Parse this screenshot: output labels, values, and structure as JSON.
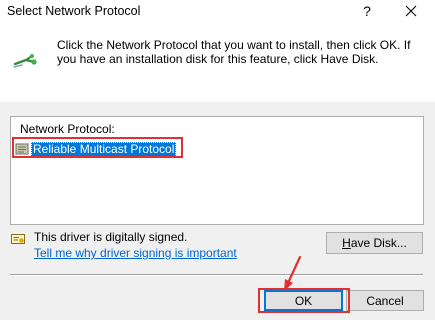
{
  "window": {
    "title": "Select Network Protocol",
    "help_glyph": "?",
    "close_glyph": "✕"
  },
  "instructions": "Click the Network Protocol that you want to install, then click OK. If you have an installation disk for this feature, click Have Disk.",
  "protocol_list": {
    "label": "Network Protocol:",
    "items": [
      {
        "label": "Reliable Multicast Protocol",
        "selected": true,
        "icon": "protocol-icon"
      }
    ]
  },
  "driver_info": {
    "status": "This driver is digitally signed.",
    "link": "Tell me why driver signing is important"
  },
  "buttons": {
    "have_disk_key": "H",
    "have_disk_rest": "ave Disk...",
    "ok": "OK",
    "cancel": "Cancel"
  },
  "colors": {
    "selection": "#0078d7",
    "link": "#0066cc",
    "annotation": "#e03030"
  }
}
